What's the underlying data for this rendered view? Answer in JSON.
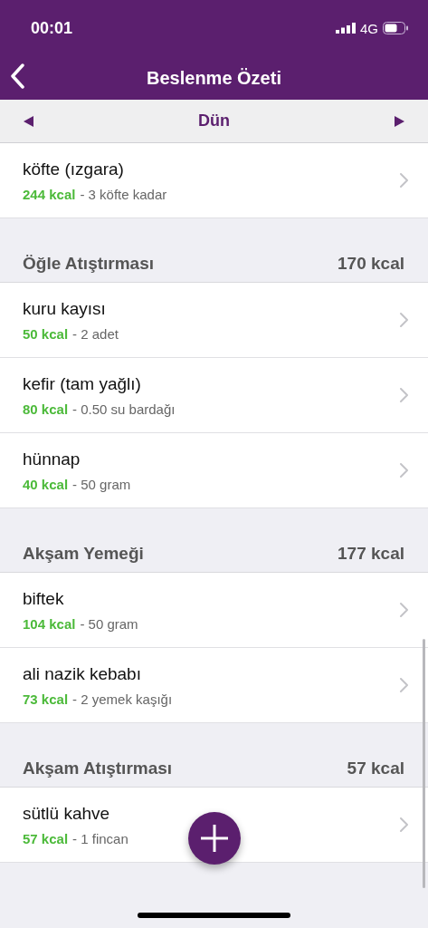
{
  "status_bar": {
    "time": "00:01",
    "network": "4G"
  },
  "nav": {
    "title": "Beslenme Özeti"
  },
  "date_bar": {
    "label": "Dün"
  },
  "sections": [
    {
      "items": [
        {
          "name": "köfte (ızgara)",
          "kcal": "244 kcal",
          "portion": "- 3 köfte kadar"
        }
      ]
    },
    {
      "title": "Öğle Atıştırması",
      "total": "170 kcal",
      "items": [
        {
          "name": "kuru kayısı",
          "kcal": "50 kcal",
          "portion": "- 2 adet"
        },
        {
          "name": "kefir (tam yağlı)",
          "kcal": "80 kcal",
          "portion": "- 0.50 su bardağı"
        },
        {
          "name": "hünnap",
          "kcal": "40 kcal",
          "portion": "- 50 gram"
        }
      ]
    },
    {
      "title": "Akşam Yemeği",
      "total": "177 kcal",
      "items": [
        {
          "name": "biftek",
          "kcal": "104 kcal",
          "portion": "- 50 gram"
        },
        {
          "name": "ali nazik kebabı",
          "kcal": "73 kcal",
          "portion": "- 2 yemek kaşığı"
        }
      ]
    },
    {
      "title": "Akşam Atıştırması",
      "total": "57 kcal",
      "items": [
        {
          "name": "sütlü kahve",
          "kcal": "57 kcal",
          "portion": "- 1 fincan"
        }
      ]
    }
  ]
}
